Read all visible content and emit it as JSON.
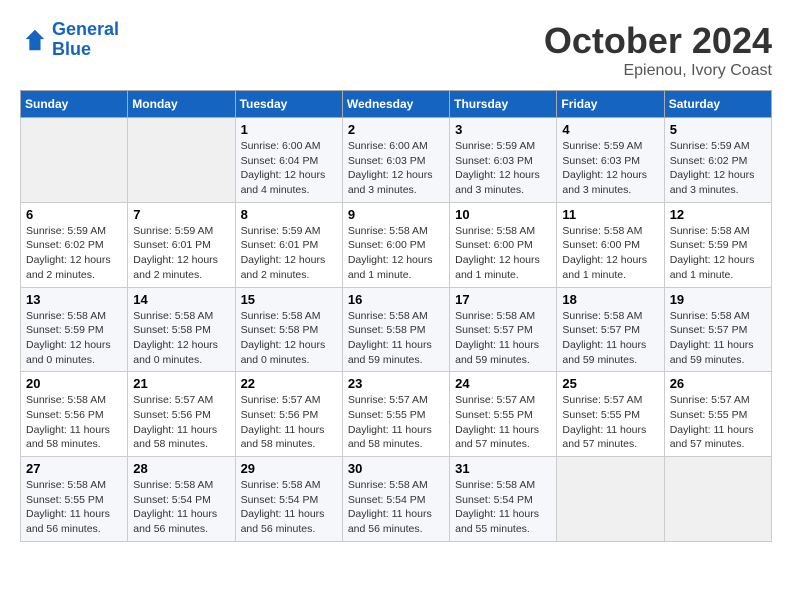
{
  "header": {
    "logo_line1": "General",
    "logo_line2": "Blue",
    "month": "October 2024",
    "location": "Epienou, Ivory Coast"
  },
  "days_of_week": [
    "Sunday",
    "Monday",
    "Tuesday",
    "Wednesday",
    "Thursday",
    "Friday",
    "Saturday"
  ],
  "weeks": [
    [
      {
        "day": "",
        "info": ""
      },
      {
        "day": "",
        "info": ""
      },
      {
        "day": "1",
        "info": "Sunrise: 6:00 AM\nSunset: 6:04 PM\nDaylight: 12 hours\nand 4 minutes."
      },
      {
        "day": "2",
        "info": "Sunrise: 6:00 AM\nSunset: 6:03 PM\nDaylight: 12 hours\nand 3 minutes."
      },
      {
        "day": "3",
        "info": "Sunrise: 5:59 AM\nSunset: 6:03 PM\nDaylight: 12 hours\nand 3 minutes."
      },
      {
        "day": "4",
        "info": "Sunrise: 5:59 AM\nSunset: 6:03 PM\nDaylight: 12 hours\nand 3 minutes."
      },
      {
        "day": "5",
        "info": "Sunrise: 5:59 AM\nSunset: 6:02 PM\nDaylight: 12 hours\nand 3 minutes."
      }
    ],
    [
      {
        "day": "6",
        "info": "Sunrise: 5:59 AM\nSunset: 6:02 PM\nDaylight: 12 hours\nand 2 minutes."
      },
      {
        "day": "7",
        "info": "Sunrise: 5:59 AM\nSunset: 6:01 PM\nDaylight: 12 hours\nand 2 minutes."
      },
      {
        "day": "8",
        "info": "Sunrise: 5:59 AM\nSunset: 6:01 PM\nDaylight: 12 hours\nand 2 minutes."
      },
      {
        "day": "9",
        "info": "Sunrise: 5:58 AM\nSunset: 6:00 PM\nDaylight: 12 hours\nand 1 minute."
      },
      {
        "day": "10",
        "info": "Sunrise: 5:58 AM\nSunset: 6:00 PM\nDaylight: 12 hours\nand 1 minute."
      },
      {
        "day": "11",
        "info": "Sunrise: 5:58 AM\nSunset: 6:00 PM\nDaylight: 12 hours\nand 1 minute."
      },
      {
        "day": "12",
        "info": "Sunrise: 5:58 AM\nSunset: 5:59 PM\nDaylight: 12 hours\nand 1 minute."
      }
    ],
    [
      {
        "day": "13",
        "info": "Sunrise: 5:58 AM\nSunset: 5:59 PM\nDaylight: 12 hours\nand 0 minutes."
      },
      {
        "day": "14",
        "info": "Sunrise: 5:58 AM\nSunset: 5:58 PM\nDaylight: 12 hours\nand 0 minutes."
      },
      {
        "day": "15",
        "info": "Sunrise: 5:58 AM\nSunset: 5:58 PM\nDaylight: 12 hours\nand 0 minutes."
      },
      {
        "day": "16",
        "info": "Sunrise: 5:58 AM\nSunset: 5:58 PM\nDaylight: 11 hours\nand 59 minutes."
      },
      {
        "day": "17",
        "info": "Sunrise: 5:58 AM\nSunset: 5:57 PM\nDaylight: 11 hours\nand 59 minutes."
      },
      {
        "day": "18",
        "info": "Sunrise: 5:58 AM\nSunset: 5:57 PM\nDaylight: 11 hours\nand 59 minutes."
      },
      {
        "day": "19",
        "info": "Sunrise: 5:58 AM\nSunset: 5:57 PM\nDaylight: 11 hours\nand 59 minutes."
      }
    ],
    [
      {
        "day": "20",
        "info": "Sunrise: 5:58 AM\nSunset: 5:56 PM\nDaylight: 11 hours\nand 58 minutes."
      },
      {
        "day": "21",
        "info": "Sunrise: 5:57 AM\nSunset: 5:56 PM\nDaylight: 11 hours\nand 58 minutes."
      },
      {
        "day": "22",
        "info": "Sunrise: 5:57 AM\nSunset: 5:56 PM\nDaylight: 11 hours\nand 58 minutes."
      },
      {
        "day": "23",
        "info": "Sunrise: 5:57 AM\nSunset: 5:55 PM\nDaylight: 11 hours\nand 58 minutes."
      },
      {
        "day": "24",
        "info": "Sunrise: 5:57 AM\nSunset: 5:55 PM\nDaylight: 11 hours\nand 57 minutes."
      },
      {
        "day": "25",
        "info": "Sunrise: 5:57 AM\nSunset: 5:55 PM\nDaylight: 11 hours\nand 57 minutes."
      },
      {
        "day": "26",
        "info": "Sunrise: 5:57 AM\nSunset: 5:55 PM\nDaylight: 11 hours\nand 57 minutes."
      }
    ],
    [
      {
        "day": "27",
        "info": "Sunrise: 5:58 AM\nSunset: 5:55 PM\nDaylight: 11 hours\nand 56 minutes."
      },
      {
        "day": "28",
        "info": "Sunrise: 5:58 AM\nSunset: 5:54 PM\nDaylight: 11 hours\nand 56 minutes."
      },
      {
        "day": "29",
        "info": "Sunrise: 5:58 AM\nSunset: 5:54 PM\nDaylight: 11 hours\nand 56 minutes."
      },
      {
        "day": "30",
        "info": "Sunrise: 5:58 AM\nSunset: 5:54 PM\nDaylight: 11 hours\nand 56 minutes."
      },
      {
        "day": "31",
        "info": "Sunrise: 5:58 AM\nSunset: 5:54 PM\nDaylight: 11 hours\nand 55 minutes."
      },
      {
        "day": "",
        "info": ""
      },
      {
        "day": "",
        "info": ""
      }
    ]
  ]
}
